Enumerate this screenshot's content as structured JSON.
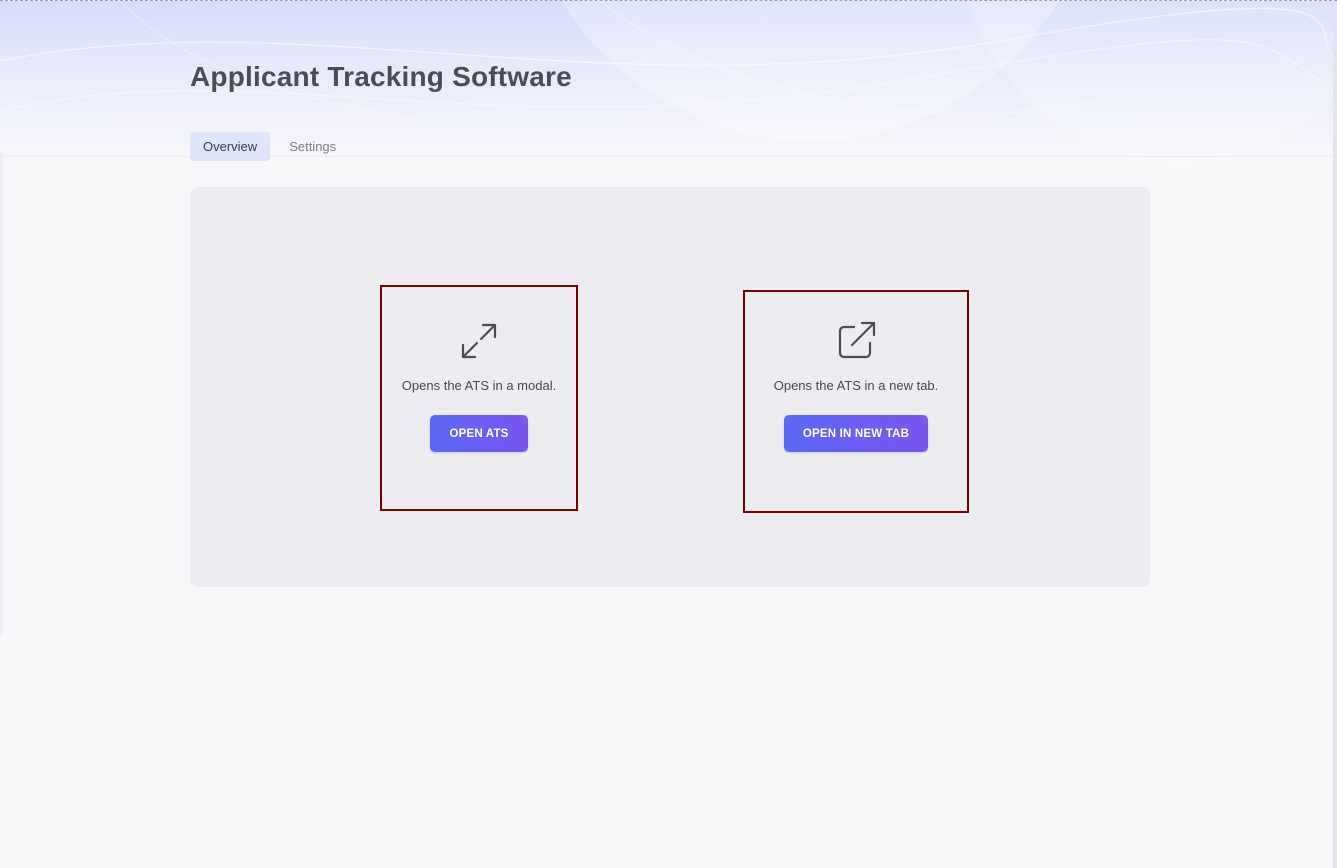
{
  "header": {
    "title": "Applicant Tracking Software"
  },
  "tabs": [
    {
      "label": "Overview",
      "active": true
    },
    {
      "label": "Settings",
      "active": false
    }
  ],
  "options": {
    "modal": {
      "icon": "expand-arrows-icon",
      "description": "Opens the ATS in a modal.",
      "button_label": "OPEN ATS"
    },
    "new_tab": {
      "icon": "external-link-icon",
      "description": "Opens the ATS in a new tab.",
      "button_label": "OPEN IN NEW TAB"
    }
  },
  "colors": {
    "accent_start": "#5a68f5",
    "accent_end": "#7a55ee",
    "highlight_border": "#7a0000",
    "active_tab_bg": "#dfe5fb"
  }
}
